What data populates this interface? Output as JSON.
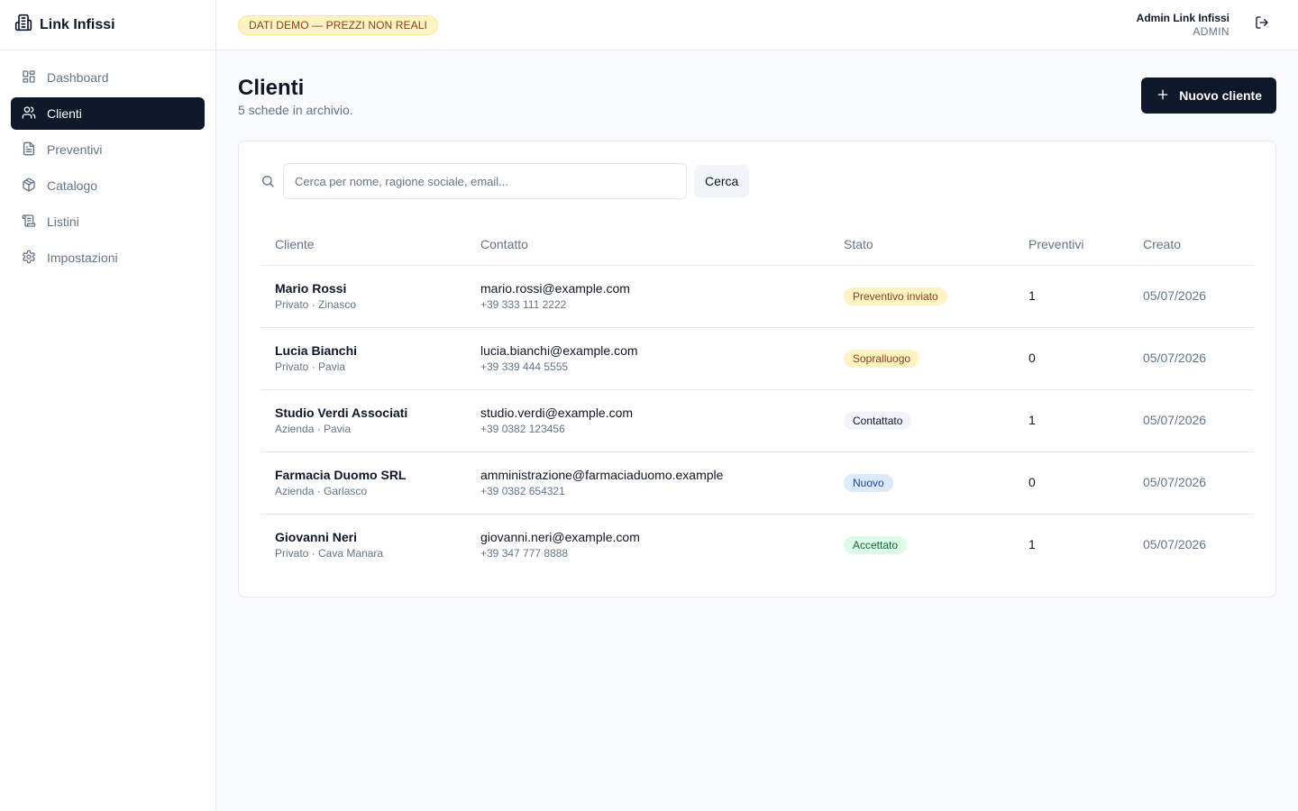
{
  "brand": {
    "name": "Link Infissi",
    "icon": "building-icon"
  },
  "sidebar": {
    "items": [
      {
        "label": "Dashboard",
        "icon": "dashboard-icon",
        "active": false
      },
      {
        "label": "Clienti",
        "icon": "users-icon",
        "active": true
      },
      {
        "label": "Preventivi",
        "icon": "document-icon",
        "active": false
      },
      {
        "label": "Catalogo",
        "icon": "box-icon",
        "active": false
      },
      {
        "label": "Listini",
        "icon": "scroll-icon",
        "active": false
      },
      {
        "label": "Impostazioni",
        "icon": "gear-icon",
        "active": false
      }
    ]
  },
  "topbar": {
    "demo_badge": "DATI DEMO — PREZZI NON REALI",
    "user_name": "Admin Link Infissi",
    "user_role": "ADMIN",
    "logout_icon": "logout-icon"
  },
  "page": {
    "title": "Clienti",
    "subtitle": "5 schede in archivio.",
    "new_button": "Nuovo cliente"
  },
  "search": {
    "placeholder": "Cerca per nome, ragione sociale, email...",
    "value": "",
    "button": "Cerca"
  },
  "table": {
    "headers": {
      "cliente": "Cliente",
      "contatto": "Contatto",
      "stato": "Stato",
      "preventivi": "Preventivi",
      "creato": "Creato"
    },
    "rows": [
      {
        "name": "Mario Rossi",
        "sub": "Privato · Zinasco",
        "email": "mario.rossi@example.com",
        "phone": "+39 333 111 2222",
        "status": "Preventivo inviato",
        "status_bg": "#fef3c7",
        "status_fg": "#92400e",
        "quotes": "1",
        "created": "05/07/2026"
      },
      {
        "name": "Lucia Bianchi",
        "sub": "Privato · Pavia",
        "email": "lucia.bianchi@example.com",
        "phone": "+39 339 444 5555",
        "status": "Sopralluogo",
        "status_bg": "#fef3c7",
        "status_fg": "#92400e",
        "quotes": "0",
        "created": "05/07/2026"
      },
      {
        "name": "Studio Verdi Associati",
        "sub": "Azienda · Pavia",
        "email": "studio.verdi@example.com",
        "phone": "+39 0382 123456",
        "status": "Contattato",
        "status_bg": "#f1f5f9",
        "status_fg": "#0f172a",
        "quotes": "1",
        "created": "05/07/2026"
      },
      {
        "name": "Farmacia Duomo SRL",
        "sub": "Azienda · Garlasco",
        "email": "amministrazione@farmaciaduomo.example",
        "phone": "+39 0382 654321",
        "status": "Nuovo",
        "status_bg": "#dbeafe",
        "status_fg": "#1e40af",
        "quotes": "0",
        "created": "05/07/2026"
      },
      {
        "name": "Giovanni Neri",
        "sub": "Privato · Cava Manara",
        "email": "giovanni.neri@example.com",
        "phone": "+39 347 777 8888",
        "status": "Accettato",
        "status_bg": "#dcfce7",
        "status_fg": "#166534",
        "quotes": "1",
        "created": "05/07/2026"
      }
    ]
  }
}
